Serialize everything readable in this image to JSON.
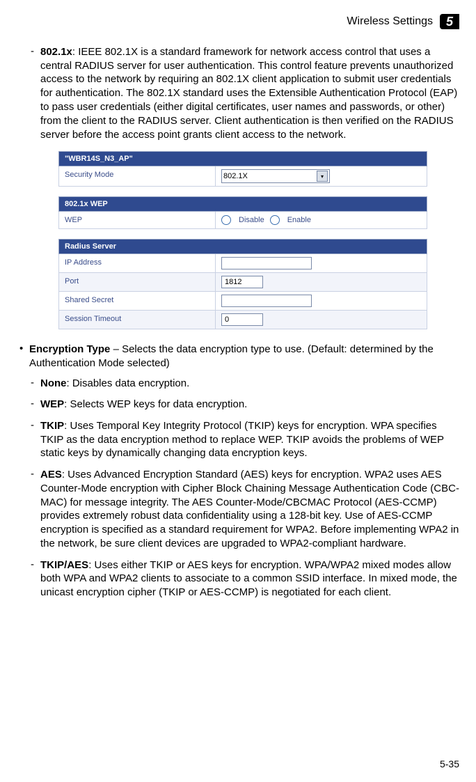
{
  "header": {
    "section": "Wireless Settings",
    "chapter": "5"
  },
  "top_item": {
    "term": "802.1x",
    "desc": ": IEEE 802.1X is a standard framework for network access control that uses a central RADIUS server for user authentication. This control feature prevents unauthorized access to the network by requiring an 802.1X client application to submit user credentials for authentication. The 802.1X standard uses the Extensible Authentication Protocol (EAP) to pass user credentials (either digital certificates, user names and passwords, or other) from the client to the RADIUS server. Client authentication is then verified on the RADIUS server before the access point grants client access to the network."
  },
  "screenshot": {
    "ap_header": "\"WBR14S_N3_AP\"",
    "security_mode_label": "Security Mode",
    "security_mode_value": "802.1X",
    "wep_header": "802.1x WEP",
    "wep_label": "WEP",
    "wep_disable": "Disable",
    "wep_enable": "Enable",
    "radius_header": "Radius Server",
    "ip_label": "IP Address",
    "ip_value": "",
    "port_label": "Port",
    "port_value": "1812",
    "secret_label": "Shared Secret",
    "secret_value": "",
    "timeout_label": "Session Timeout",
    "timeout_value": "0"
  },
  "enc_item": {
    "term": "Encryption Type",
    "desc": " – Selects the data encryption type to use. (Default: determined by the Authentication Mode selected)"
  },
  "enc_subs": {
    "none": {
      "term": "None",
      "desc": ": Disables data encryption."
    },
    "wep": {
      "term": "WEP",
      "desc": ": Selects WEP keys for data encryption."
    },
    "tkip": {
      "term": "TKIP",
      "desc": ": Uses Temporal Key Integrity Protocol (TKIP) keys for encryption. WPA specifies TKIP as the data encryption method to replace WEP. TKIP avoids the problems of WEP static keys by dynamically changing data encryption keys."
    },
    "aes": {
      "term": "AES",
      "desc": ": Uses Advanced Encryption Standard (AES) keys for encryption. WPA2 uses AES Counter-Mode encryption with Cipher Block Chaining Message Authentication Code (CBC-MAC) for message integrity. The AES Counter-Mode/CBCMAC Protocol (AES-CCMP) provides extremely robust data confidentiality using a 128-bit key. Use of AES-CCMP encryption is specified as a standard requirement for WPA2. Before implementing WPA2 in the network, be sure client devices are upgraded to WPA2-compliant hardware."
    },
    "tkipaes": {
      "term": "TKIP/AES",
      "desc": ": Uses either TKIP or AES keys for encryption. WPA/WPA2 mixed modes allow both WPA and WPA2 clients to associate to a common SSID interface. In mixed mode, the unicast encryption cipher (TKIP or AES-CCMP) is negotiated for each client."
    }
  },
  "footer": {
    "page": "5-35"
  }
}
